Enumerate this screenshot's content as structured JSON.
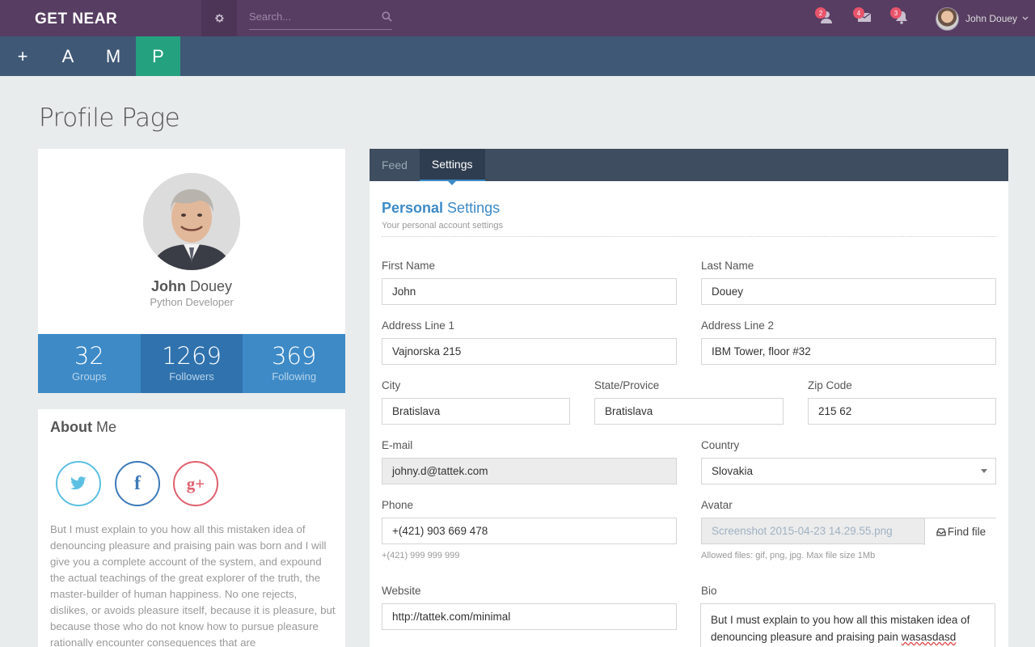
{
  "topbar": {
    "brand": "GET NEAR",
    "search_placeholder": "Search...",
    "notifications": [
      {
        "icon": "user-notification-icon",
        "count": "2"
      },
      {
        "icon": "mail-icon",
        "count": "4"
      },
      {
        "icon": "bell-icon",
        "count": "3"
      }
    ],
    "user_name": "John Douey"
  },
  "navbar": {
    "items": [
      "+",
      "A",
      "M",
      "P"
    ],
    "active": "P"
  },
  "page_title": "Profile Page",
  "profile": {
    "first_name": "John",
    "last_name": "Douey",
    "role": "Python Developer",
    "stats": [
      {
        "value": "32",
        "label": "Groups"
      },
      {
        "value": "1269",
        "label": "Followers"
      },
      {
        "value": "369",
        "label": "Following"
      }
    ]
  },
  "about": {
    "title_bold": "About",
    "title_rest": " Me",
    "social": [
      "twitter-icon",
      "facebook-icon",
      "google-plus-icon"
    ],
    "text": "But I must explain to you how all this mistaken idea of denouncing pleasure and praising pain was born and I will give you a complete account of the system, and expound the actual teachings of the great explorer of the truth, the master-builder of human happiness. No one rejects, dislikes, or avoids pleasure itself, because it is pleasure, but because those who do not know how to pursue pleasure rationally encounter consequences that are"
  },
  "tabs": [
    {
      "label": "Feed"
    },
    {
      "label": "Settings"
    }
  ],
  "settings": {
    "title_bold": "Personal",
    "title_rest": " Settings",
    "subtitle": "Your personal account settings",
    "first_name_label": "First Name",
    "first_name_value": "John",
    "last_name_label": "Last Name",
    "last_name_value": "Douey",
    "address1_label": "Address Line 1",
    "address1_value": "Vajnorska 215",
    "address2_label": "Address Line 2",
    "address2_value": "IBM Tower, floor #32",
    "city_label": "City",
    "city_value": "Bratislava",
    "state_label": "State/Provice",
    "state_value": "Bratislava",
    "zip_label": "Zip Code",
    "zip_value": "215 62",
    "email_label": "E-mail",
    "email_value": "johny.d@tattek.com",
    "country_label": "Country",
    "country_value": "Slovakia",
    "phone_label": "Phone",
    "phone_value": "+(421) 903 669 478",
    "phone_help": "+(421) 999 999 999",
    "avatar_label": "Avatar",
    "avatar_value": "Screenshot 2015-04-23 14.29.55.png",
    "avatar_button": "Find file",
    "avatar_help": "Allowed files: gif, png, jpg. Max file size 1Mb",
    "website_label": "Website",
    "website_value": "http://tattek.com/minimal",
    "bio_label": "Bio",
    "bio_value": "But I must explain to you how all this mistaken idea of denouncing pleasure and praising pain",
    "bio_misspelled": "wasasdasd"
  }
}
